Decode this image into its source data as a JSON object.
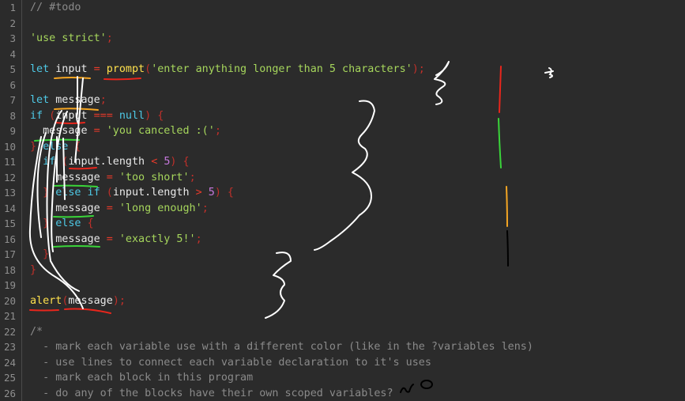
{
  "editor": {
    "lines": [
      {
        "n": "1",
        "tokens": [
          {
            "t": "// #todo",
            "c": "com"
          }
        ]
      },
      {
        "n": "2",
        "tokens": []
      },
      {
        "n": "3",
        "tokens": [
          {
            "t": "'use strict'",
            "c": "str"
          },
          {
            "t": ";",
            "c": "pun"
          }
        ]
      },
      {
        "n": "4",
        "tokens": []
      },
      {
        "n": "5",
        "tokens": [
          {
            "t": "let",
            "c": "kw"
          },
          {
            "t": " input ",
            "c": "txt"
          },
          {
            "t": "=",
            "c": "op"
          },
          {
            "t": " ",
            "c": "txt"
          },
          {
            "t": "prompt",
            "c": "fn"
          },
          {
            "t": "(",
            "c": "pun"
          },
          {
            "t": "'enter anything longer than 5 characters'",
            "c": "str"
          },
          {
            "t": ");",
            "c": "pun"
          }
        ]
      },
      {
        "n": "6",
        "tokens": []
      },
      {
        "n": "7",
        "tokens": [
          {
            "t": "let",
            "c": "kw"
          },
          {
            "t": " message",
            "c": "txt"
          },
          {
            "t": ";",
            "c": "pun"
          }
        ]
      },
      {
        "n": "8",
        "tokens": [
          {
            "t": "if",
            "c": "kw"
          },
          {
            "t": " (",
            "c": "pun"
          },
          {
            "t": "input ",
            "c": "txt"
          },
          {
            "t": "===",
            "c": "op"
          },
          {
            "t": " ",
            "c": "txt"
          },
          {
            "t": "null",
            "c": "kw"
          },
          {
            "t": ") {",
            "c": "pun"
          }
        ]
      },
      {
        "n": "9",
        "tokens": [
          {
            "t": "  message ",
            "c": "txt"
          },
          {
            "t": "=",
            "c": "op"
          },
          {
            "t": " ",
            "c": "txt"
          },
          {
            "t": "'you canceled :('",
            "c": "str"
          },
          {
            "t": ";",
            "c": "pun"
          }
        ]
      },
      {
        "n": "10",
        "tokens": [
          {
            "t": "} ",
            "c": "pun"
          },
          {
            "t": "else",
            "c": "kw"
          },
          {
            "t": " {",
            "c": "pun"
          }
        ]
      },
      {
        "n": "11",
        "tokens": [
          {
            "t": "  ",
            "c": "txt"
          },
          {
            "t": "if",
            "c": "kw"
          },
          {
            "t": " (",
            "c": "pun"
          },
          {
            "t": "input.length ",
            "c": "txt"
          },
          {
            "t": "<",
            "c": "op"
          },
          {
            "t": " ",
            "c": "txt"
          },
          {
            "t": "5",
            "c": "num"
          },
          {
            "t": ") {",
            "c": "pun"
          }
        ]
      },
      {
        "n": "12",
        "tokens": [
          {
            "t": "    message ",
            "c": "txt"
          },
          {
            "t": "=",
            "c": "op"
          },
          {
            "t": " ",
            "c": "txt"
          },
          {
            "t": "'too short'",
            "c": "str"
          },
          {
            "t": ";",
            "c": "pun"
          }
        ]
      },
      {
        "n": "13",
        "tokens": [
          {
            "t": "  } ",
            "c": "pun"
          },
          {
            "t": "else if",
            "c": "kw"
          },
          {
            "t": " (",
            "c": "pun"
          },
          {
            "t": "input.length ",
            "c": "txt"
          },
          {
            "t": ">",
            "c": "op"
          },
          {
            "t": " ",
            "c": "txt"
          },
          {
            "t": "5",
            "c": "num"
          },
          {
            "t": ") {",
            "c": "pun"
          }
        ]
      },
      {
        "n": "14",
        "tokens": [
          {
            "t": "    message ",
            "c": "txt"
          },
          {
            "t": "=",
            "c": "op"
          },
          {
            "t": " ",
            "c": "txt"
          },
          {
            "t": "'long enough'",
            "c": "str"
          },
          {
            "t": ";",
            "c": "pun"
          }
        ]
      },
      {
        "n": "15",
        "tokens": [
          {
            "t": "  } ",
            "c": "pun"
          },
          {
            "t": "else",
            "c": "kw"
          },
          {
            "t": " {",
            "c": "pun"
          }
        ]
      },
      {
        "n": "16",
        "tokens": [
          {
            "t": "    message ",
            "c": "txt"
          },
          {
            "t": "=",
            "c": "op"
          },
          {
            "t": " ",
            "c": "txt"
          },
          {
            "t": "'exactly 5!'",
            "c": "str"
          },
          {
            "t": ";",
            "c": "pun"
          }
        ]
      },
      {
        "n": "17",
        "tokens": [
          {
            "t": "  }",
            "c": "pun"
          }
        ]
      },
      {
        "n": "18",
        "tokens": [
          {
            "t": "}",
            "c": "pun"
          }
        ]
      },
      {
        "n": "19",
        "tokens": []
      },
      {
        "n": "20",
        "tokens": [
          {
            "t": "alert",
            "c": "fn"
          },
          {
            "t": "(",
            "c": "pun"
          },
          {
            "t": "message",
            "c": "txt"
          },
          {
            "t": ");",
            "c": "pun"
          }
        ]
      },
      {
        "n": "21",
        "tokens": []
      },
      {
        "n": "22",
        "tokens": [
          {
            "t": "/*",
            "c": "com"
          }
        ]
      },
      {
        "n": "23",
        "tokens": [
          {
            "t": "  - mark each variable use with a different color (like in the ?variables lens)",
            "c": "com"
          }
        ]
      },
      {
        "n": "24",
        "tokens": [
          {
            "t": "  - use lines to connect each variable declaration to it's uses",
            "c": "com"
          }
        ]
      },
      {
        "n": "25",
        "tokens": [
          {
            "t": "  - mark each block in this program",
            "c": "com"
          }
        ]
      },
      {
        "n": "26",
        "tokens": [
          {
            "t": "  - do any of the blocks have their own scoped variables?",
            "c": "com"
          }
        ]
      }
    ],
    "annotation_answer": "no",
    "colors": {
      "background": "#2b2b2b",
      "keyword": "#4ec9e6",
      "string": "#a6d65c",
      "function": "#ffe14d",
      "number": "#c678dd",
      "operator": "#e83a2a",
      "punctuation": "#c0302a",
      "comment": "#8a8a8a",
      "ink_white": "#ffffff",
      "ink_orange": "#f5a623",
      "ink_red": "#e8261c",
      "ink_green": "#3ad43a",
      "ink_black": "#000000"
    }
  }
}
